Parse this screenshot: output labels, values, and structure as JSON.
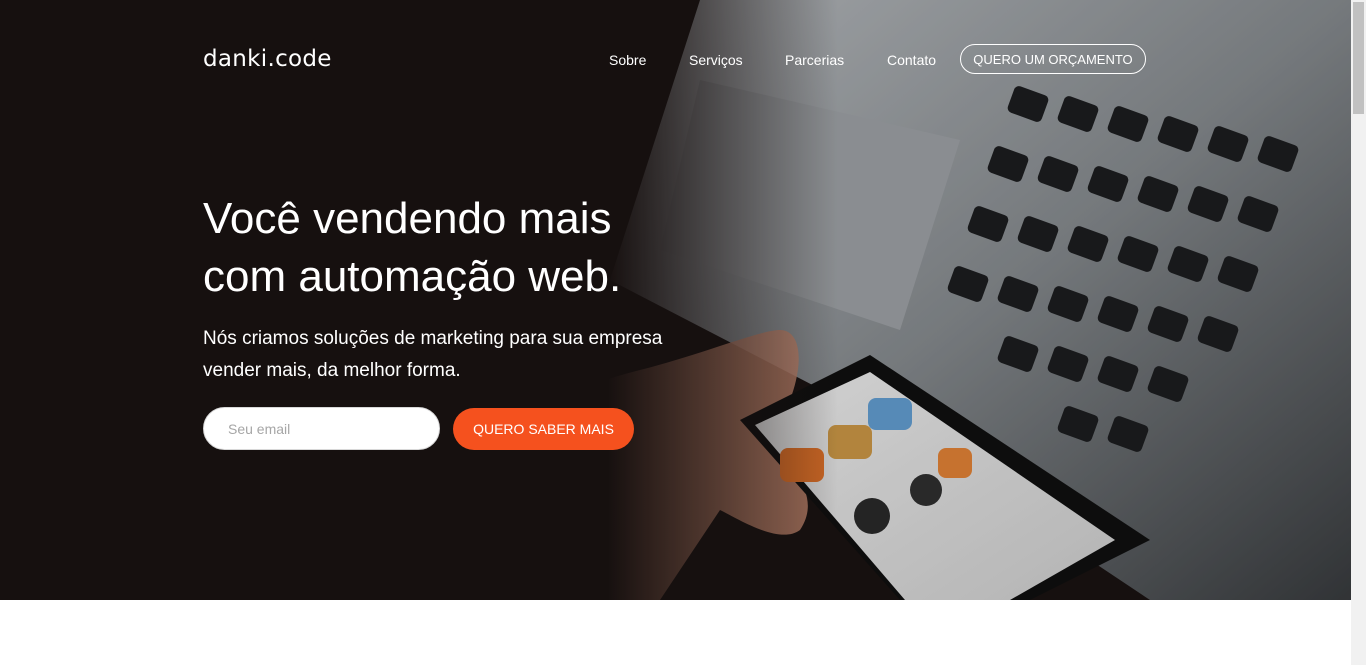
{
  "brand": {
    "logo_text": "danki.code"
  },
  "nav": {
    "items": [
      {
        "label": "Sobre"
      },
      {
        "label": "Serviços"
      },
      {
        "label": "Parcerias"
      },
      {
        "label": "Contato"
      }
    ],
    "cta_label": "QUERO UM ORÇAMENTO"
  },
  "hero": {
    "title_line1": "Você vendendo mais",
    "title_line2": "com automação web.",
    "subtitle_line1": "Nós criamos soluções de marketing para sua empresa",
    "subtitle_line2": "vender mais, da melhor forma.",
    "email_placeholder": "Seu email",
    "submit_label": "QUERO SABER MAIS"
  },
  "colors": {
    "accent": "#f5511e",
    "hero_dark": "#1c1413",
    "text_light": "#ffffff"
  },
  "icons": [
    "laptop-photo",
    "smartphone-photo",
    "hand-photo"
  ]
}
